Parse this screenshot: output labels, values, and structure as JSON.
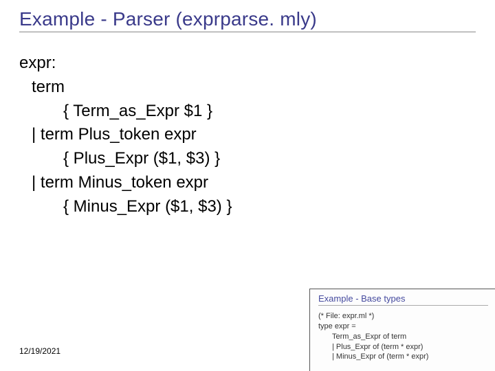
{
  "slide": {
    "title": "Example - Parser (exprparse. mly)",
    "rule_head": "expr:",
    "prod1": "term",
    "action1": "{ Term_as_Expr $1 }",
    "prod2": "| term Plus_token expr",
    "action2": "{ Plus_Expr ($1, $3) }",
    "prod3": "| term Minus_token expr",
    "action3": "{ Minus_Expr ($1, $3) }",
    "date": "12/19/2021"
  },
  "thumb": {
    "title": "Example - Base types",
    "line1": "(* File: expr.ml *)",
    "line2": "type expr =",
    "line3": "Term_as_Expr of term",
    "line4": "| Plus_Expr of (term * expr)",
    "line5": "| Minus_Expr of (term * expr)"
  }
}
